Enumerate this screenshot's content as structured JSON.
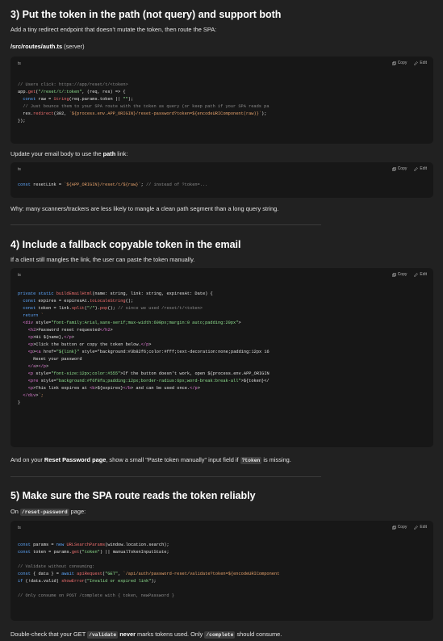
{
  "s3": {
    "title": "3) Put the token in the path (not query) and support both",
    "intro": "Add a tiny redirect endpoint that doesn't mutate the token, then route the SPA:",
    "file": "/src/routes/auth.ts",
    "file_suffix": " (server)",
    "update_prefix": "Update your email body to use the ",
    "update_bold": "path",
    "update_suffix": " link:",
    "why": "Why: many scanners/trackers are less likely to mangle a clean path segment than a long query string."
  },
  "s4": {
    "title": "4) Include a fallback copyable token in the email",
    "intro": "If a client still mangles the link, the user can paste the token manually.",
    "note_prefix": "And on your ",
    "note_bold": "Reset Password page",
    "note_mid": ", show a small \"Paste token manually\" input field if ",
    "note_code": "?token",
    "note_suffix": " is missing."
  },
  "s5": {
    "title": "5) Make sure the SPA route reads the token reliably",
    "on_prefix": "On ",
    "on_code": "/reset-password",
    "on_suffix": " page:",
    "final_a": "Double-check that your GET ",
    "final_code1": "/validate",
    "final_b": " never",
    "final_c": " marks tokens used. Only ",
    "final_code2": "/complete",
    "final_d": " should consume."
  },
  "code_ui": {
    "lang": "ts",
    "copy": "Copy",
    "edit": "Edit"
  },
  "code1": [
    "",
    "// Users click: https://app/reset/t/<token>",
    "app.get(\"/reset/t/:token\", (req, res) => {",
    "  const raw = String(req.params.token || \"\");",
    "  // Just bounce them to your SPA route with the token as query (or keep path if your SPA reads pa",
    "  res.redirect(302, `${process.env.APP_ORIGIN}/reset-password?token=${encodeURIComponent(raw)}`);",
    "});"
  ],
  "code2": [
    "const resetLink = `${APP_ORIGIN}/reset/t/${raw}`; // instead of ?token=..."
  ],
  "code3": [
    "private static buildEmailHtml(name: string, link: string, expiresAt: Date) {",
    "  const expires = expiresAt.toLocaleString();",
    "  const token = link.split(\"/\").pop(); // since we used /reset/t/<token>",
    "  return `",
    "  <div style=\"font-family:Arial,sans-serif;max-width:600px;margin:0 auto;padding:20px\">",
    "    <h2>Password reset requested</h2>",
    "    <p>Hi ${name},</p>",
    "    <p>Click the button or copy the token below.</p>",
    "    <p><a href=\"${link}\" style=\"background:#3b82f6;color:#fff;text-decoration:none;padding:12px 16",
    "      Reset your password",
    "    </a></p>",
    "    <p style=\"font-size:12px;color:#555\">If the button doesn't work, open ${process.env.APP_ORIGIN",
    "    <pre style=\"background:#f6f8fa;padding:12px;border-radius:6px;word-break:break-all\">${token}</",
    "    <p>This link expires at <b>${expires}</b> and can be used once.</p>",
    "  </div>`;",
    "}"
  ],
  "code4": [
    "const params = new URLSearchParams(window.location.search);",
    "const token = params.get(\"token\") || manualTokenInputState;",
    "",
    "// Validate without consuming:",
    "const { data } = await apiRequest(\"GET\", `/api/auth/password-reset/validate?token=${encodeURIComponent",
    "if (!data.valid) showError(\"Invalid or expired link\");",
    "",
    "// Only consume on POST /complete with { token, newPassword }"
  ],
  "colors": {
    "bg": "#212121",
    "code_bg": "#171717",
    "keyword": "#5ea8ff",
    "string": "#8fe08f",
    "function": "#f06f6f",
    "comment": "#8a8a8a"
  },
  "icons": {
    "copy": "copy-icon",
    "edit": "pencil-icon"
  }
}
